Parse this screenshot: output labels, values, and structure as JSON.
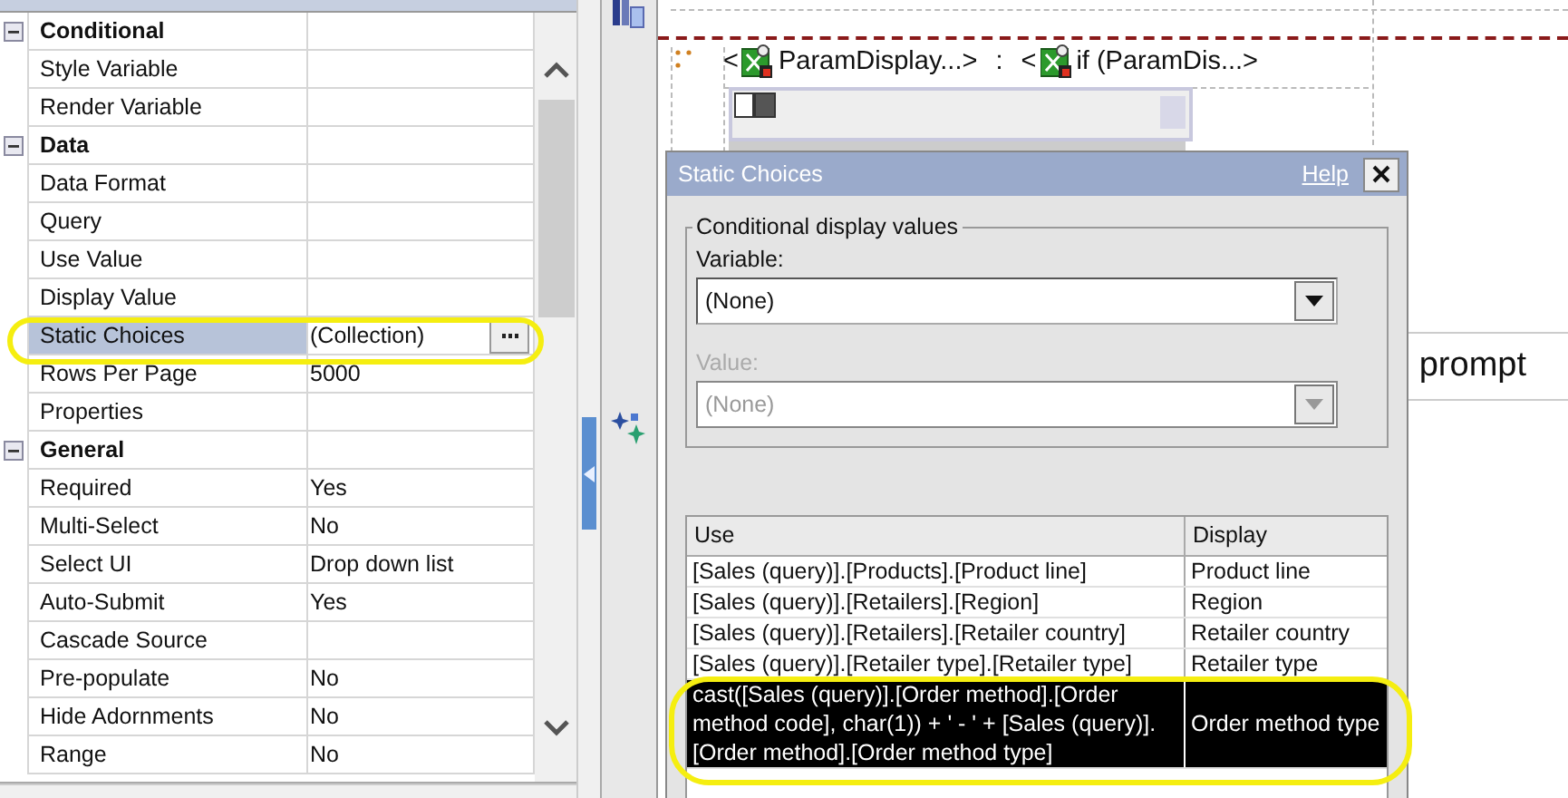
{
  "property_grid": {
    "groups": [
      {
        "name": "Conditional",
        "expanded": true,
        "children": [
          {
            "name": "Style Variable",
            "selected": false
          },
          {
            "name": "Render Variable",
            "selected": false
          }
        ]
      },
      {
        "name": "Data",
        "expanded": true,
        "children": [
          {
            "name": "Data Format",
            "selected": false
          },
          {
            "name": "Query",
            "selected": false
          },
          {
            "name": "Use Value",
            "selected": false
          },
          {
            "name": "Display Value",
            "selected": false
          },
          {
            "name": "Static Choices",
            "value": "(Collection)",
            "kind": "collection",
            "selected": true
          },
          {
            "name": "Rows Per Page",
            "value": "5000",
            "selected": false
          },
          {
            "name": "Properties",
            "selected": false
          }
        ]
      },
      {
        "name": "General",
        "expanded": true,
        "children": [
          {
            "name": "Required",
            "value": "Yes",
            "selected": false
          },
          {
            "name": "Multi-Select",
            "value": "No",
            "selected": false
          },
          {
            "name": "Select UI",
            "value": "Drop down list",
            "selected": false
          },
          {
            "name": "Auto-Submit",
            "value": "Yes",
            "selected": false
          },
          {
            "name": "Cascade Source",
            "selected": false
          },
          {
            "name": "Pre-populate",
            "value": "No",
            "selected": false
          },
          {
            "name": "Hide Adornments",
            "value": "No",
            "selected": false
          },
          {
            "name": "Range",
            "value": "No",
            "selected": false
          }
        ]
      }
    ]
  },
  "canvas": {
    "tokens": [
      {
        "kind": "bracket",
        "text": "<"
      },
      {
        "kind": "data_item",
        "text": "ParamDisplay...>"
      },
      {
        "kind": "separator",
        "text": ":"
      },
      {
        "kind": "bracket",
        "text": "<"
      },
      {
        "kind": "data_item",
        "text": "if (ParamDis...>"
      }
    ],
    "prompt_text": "prompt"
  },
  "static_choices_dialog": {
    "title": "Static Choices",
    "help": "Help",
    "group_title": "Conditional display values",
    "variable": {
      "label": "Variable:",
      "value": "(None)",
      "disabled": false
    },
    "value": {
      "label": "Value:",
      "value": "(None)",
      "disabled": true
    },
    "table": {
      "columns": [
        "Use",
        "Display"
      ],
      "rows": [
        {
          "use": "[Sales (query)].[Products].[Product line]",
          "display": "Product line",
          "selected": false
        },
        {
          "use": "[Sales (query)].[Retailers].[Region]",
          "display": "Region",
          "selected": false
        },
        {
          "use": "[Sales (query)].[Retailers].[Retailer country]",
          "display": "Retailer country",
          "selected": false
        },
        {
          "use": "[Sales (query)].[Retailer type].[Retailer type]",
          "display": "Retailer type",
          "selected": false
        },
        {
          "use": "cast([Sales (query)].[Order method].[Order method code], char(1)) + ' - ' + [Sales (query)].[Order method].[Order method type]",
          "display": "Order method type",
          "selected": true
        }
      ]
    }
  }
}
